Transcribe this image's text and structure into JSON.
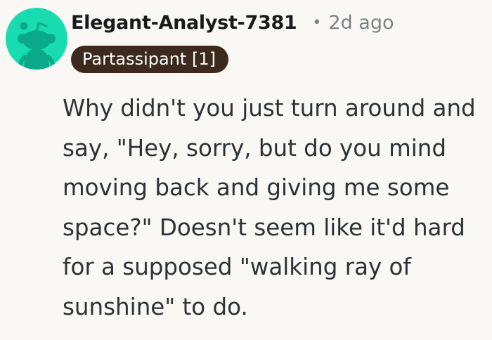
{
  "comment": {
    "avatar_icon": "reddit-snoo-avatar-icon",
    "avatar_color": "#18dcb0",
    "username": "Elegant-Analyst-7381",
    "separator": "•",
    "timestamp": "2d ago",
    "flair": "Partassipant [1]",
    "flair_color": "#3d2a1f",
    "body": "Why didn't you just turn around and say, \"Hey, sorry, but do you mind moving back and giving me some space?\" Doesn't seem like it'd hard for a supposed \"walking ray of sunshine\" to do."
  }
}
